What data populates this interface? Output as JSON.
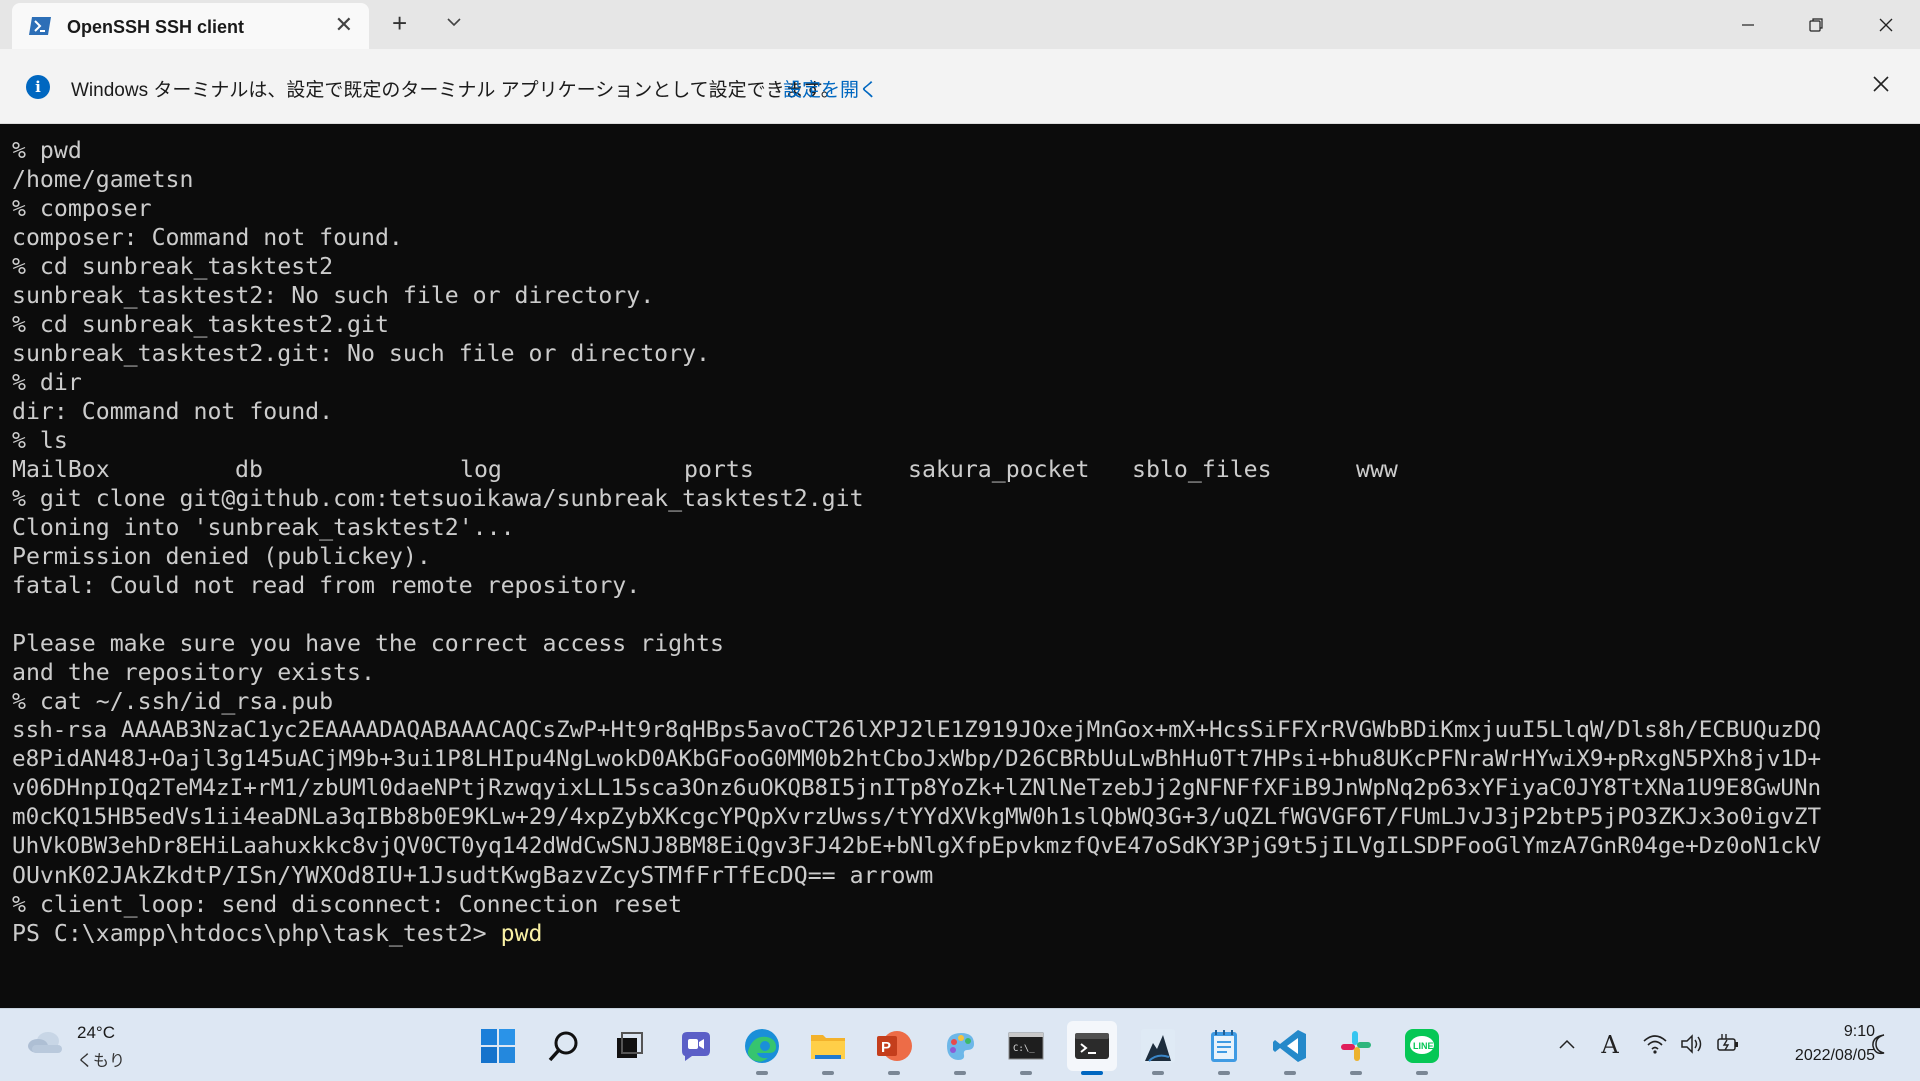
{
  "window": {
    "tab_title": "OpenSSH SSH client",
    "new_tab_label": "+"
  },
  "infobar": {
    "message": "Windows ターミナルは、設定で既定のターミナル アプリケーションとして設定できます。",
    "link": "設定を開く"
  },
  "terminal": {
    "lines": [
      "% pwd",
      "/home/gametsn",
      "% composer",
      "composer: Command not found.",
      "% cd sunbreak_tasktest2",
      "sunbreak_tasktest2: No such file or directory.",
      "% cd sunbreak_tasktest2.git",
      "sunbreak_tasktest2.git: No such file or directory.",
      "% dir",
      "dir: Command not found.",
      "% ls",
      "",
      "% git clone git@github.com:tetsuoikawa/sunbreak_tasktest2.git",
      "Cloning into 'sunbreak_tasktest2'...",
      "Permission denied (publickey).",
      "fatal: Could not read from remote repository.",
      "",
      "Please make sure you have the correct access rights",
      "and the repository exists.",
      "% cat ~/.ssh/id_rsa.pub",
      "ssh-rsa AAAAB3NzaC1yc2EAAAADAQABAAACAQCsZwP+Ht9r8qHBps5avoCT26lXPJ2lE1Z919JOxejMnGox+mX+HcsSiFFXrRVGWbBDiKmxjuuI5LlqW/Dls8h/ECBUQuzDQ",
      "e8PidAN48J+Oajl3g145uACjM9b+3ui1P8LHIpu4NgLwokD0AKbGFooG0MM0b2htCboJxWbp/D26CBRbUuLwBhHu0Tt7HPsi+bhu8UKcPFNraWrHYwiX9+pRxgN5PXh8jv1D+",
      "v06DHnpIQq2TeM4zI+rM1/zbUMl0daeNPtjRzwqyixLL15sca3Onz6uOKQB8I5jnITp8YoZk+lZNlNeTzebJj2gNFNFfXFiB9JnWpNq2p63xYFiyaC0JY8TtXNa1U9E8GwUNn",
      "m0cKQ15HB5edVs1ii4eaDNLa3qIBb8b0E9KLw+29/4xpZybXKcgcYPQpXvrzUwss/tYYdXVkgMW0h1slQbWQ3G+3/uQZLfWGVGF6T/FUmLJvJ3jP2btP5jPO3ZKJx3o0igvZT",
      "UhVkOBW3ehDr8EHiLaahuxkkc8vjQV0CT0yq142dWdCwSNJJ8BM8EiQgv3FJ42bE+bNlgXfpEpvkmzfQvE47oSdKY3PjG9t5jILVgILSDPFooGlYmzA7GnR04ge+Dz0oN1ckV",
      "OUvnK02JAkZkdtP/ISn/YWXOd8IU+1JsudtKwgBazvZcySTMfFrTfEcDQ== arrowm",
      "% client_loop: send disconnect: Connection reset"
    ],
    "ls_items": [
      "MailBox",
      "db",
      "log",
      "ports",
      "sakura_pocket",
      "sblo_files",
      "www"
    ],
    "ps_prompt": "PS C:\\xampp\\htdocs\\php\\task_test2> ",
    "ps_command": "pwd"
  },
  "taskbar": {
    "weather_temp": "24°C",
    "weather_cond": "くもり",
    "apps": [
      "start-icon",
      "search-icon",
      "task-view-icon",
      "teams-chat-icon",
      "edge-icon",
      "file-explorer-icon",
      "powerpoint-icon",
      "paint-icon",
      "command-prompt-icon",
      "windows-terminal-icon",
      "app-icon",
      "notepad-icon",
      "vscode-icon",
      "slack-icon",
      "line-icon"
    ],
    "tray_ime": "A",
    "time": "9:10",
    "date": "2022/08/05"
  },
  "colors": {
    "terminal_bg": "#0c0c0c",
    "terminal_fg": "#cccccc",
    "command_highlight": "#f9f1a5",
    "accent": "#0067c0"
  }
}
